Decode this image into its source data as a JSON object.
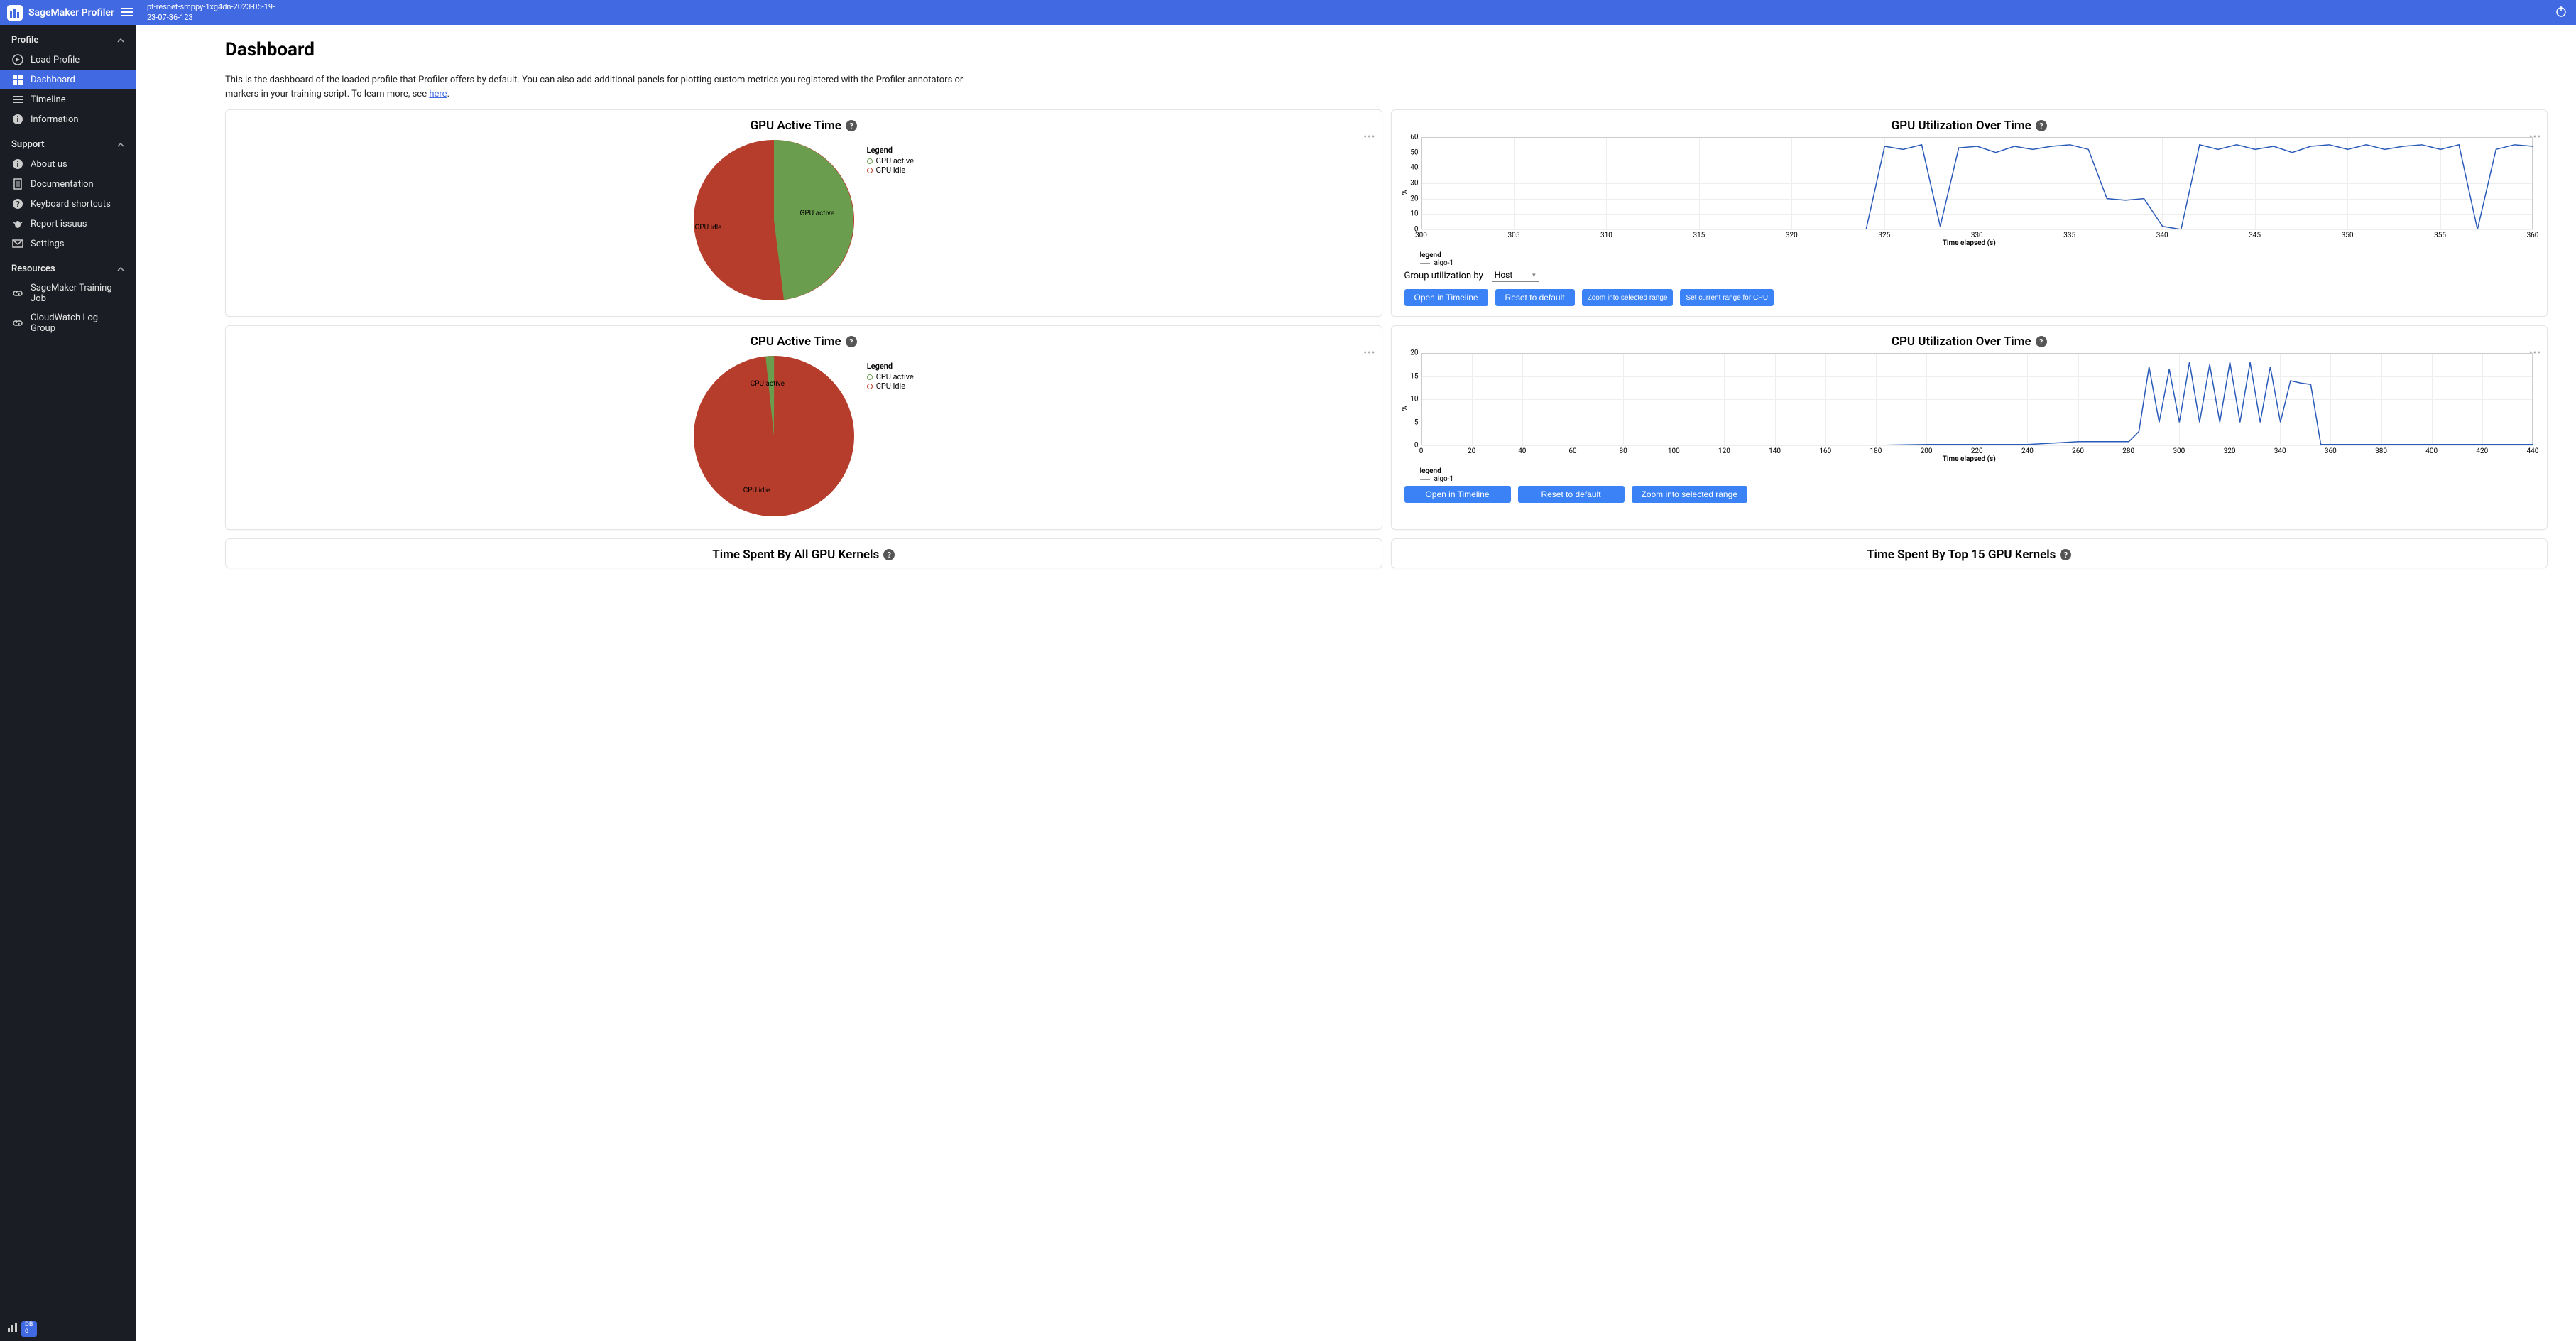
{
  "header": {
    "title": "SageMaker Profiler",
    "job_path_line1": "pt-resnet-smppy-1xg4dn-2023-05-19-",
    "job_path_line2": "23-07-36-123"
  },
  "sidebar": {
    "sections": {
      "profile": {
        "title": "Profile",
        "items": [
          "Load Profile",
          "Dashboard",
          "Timeline",
          "Information"
        ]
      },
      "support": {
        "title": "Support",
        "items": [
          "About us",
          "Documentation",
          "Keyboard shortcuts",
          "Report issuus",
          "Settings"
        ]
      },
      "resources": {
        "title": "Resources",
        "items": [
          "SageMaker Training Job",
          "CloudWatch Log Group"
        ]
      }
    },
    "footer_badge": {
      "top": "DB",
      "bottom": "0"
    }
  },
  "main": {
    "title": "Dashboard",
    "subtitle_prefix": "This is the dashboard of the loaded profile that Profiler offers by default. You can also add additional panels for plotting custom metrics you registered with the Profiler annotators or markers in your training script. To learn more, see ",
    "subtitle_link": "here",
    "subtitle_suffix": "."
  },
  "panels": {
    "gpu_pie": {
      "title": "GPU Active Time",
      "legend_title": "Legend",
      "legend_items": [
        "GPU active",
        "GPU idle"
      ],
      "label_active": "GPU active",
      "label_idle": "GPU idle"
    },
    "gpu_line": {
      "title": "GPU Utilization Over Time",
      "ylabel": "%",
      "xlabel": "Time elapsed (s)",
      "legend_title": "legend",
      "series_name": "algo-1",
      "group_label": "Group utilization by",
      "group_value": "Host",
      "buttons": [
        "Open in Timeline",
        "Reset to default",
        "Zoom into selected range",
        "Set current range for CPU"
      ]
    },
    "cpu_pie": {
      "title": "CPU Active Time",
      "legend_title": "Legend",
      "legend_items": [
        "CPU active",
        "CPU idle"
      ],
      "label_active": "CPU active",
      "label_idle": "CPU idle"
    },
    "cpu_line": {
      "title": "CPU Utilization Over Time",
      "ylabel": "%",
      "xlabel": "Time elapsed (s)",
      "legend_title": "legend",
      "series_name": "algo-1",
      "buttons": [
        "Open in Timeline",
        "Reset to default",
        "Zoom into selected range"
      ]
    },
    "bottom_left": {
      "title": "Time Spent By All GPU Kernels"
    },
    "bottom_right": {
      "title": "Time Spent By Top 15 GPU Kernels"
    }
  },
  "colors": {
    "green": "#6a9e4e",
    "red": "#b63d2b",
    "blue_line": "#2a5ab8"
  },
  "chart_data": [
    {
      "id": "gpu_pie",
      "type": "pie",
      "title": "GPU Active Time",
      "series": [
        {
          "name": "GPU active",
          "value": 52,
          "color": "#6a9e4e"
        },
        {
          "name": "GPU idle",
          "value": 48,
          "color": "#b63d2b"
        }
      ]
    },
    {
      "id": "gpu_util_line",
      "type": "line",
      "title": "GPU Utilization Over Time",
      "xlabel": "Time elapsed (s)",
      "ylabel": "%",
      "ylim": [
        0,
        60
      ],
      "xlim": [
        300,
        360
      ],
      "x_ticks": [
        300,
        305,
        310,
        315,
        320,
        325,
        330,
        335,
        340,
        345,
        350,
        355,
        360
      ],
      "y_ticks": [
        0,
        10,
        20,
        30,
        40,
        50,
        60
      ],
      "series": [
        {
          "name": "algo-1",
          "x": [
            300,
            305,
            310,
            315,
            320,
            323,
            324,
            325,
            326,
            327,
            328,
            329,
            330,
            331,
            332,
            333,
            334,
            335,
            336,
            337,
            338,
            339,
            340,
            341,
            342,
            343,
            344,
            345,
            346,
            347,
            348,
            349,
            350,
            351,
            352,
            353,
            354,
            355,
            356,
            357,
            358,
            359,
            360
          ],
          "values": [
            0,
            0,
            0,
            0,
            0,
            0,
            0,
            54,
            52,
            55,
            2,
            53,
            54,
            50,
            54,
            52,
            54,
            55,
            52,
            20,
            19,
            20,
            2,
            0,
            55,
            52,
            55,
            52,
            54,
            50,
            54,
            55,
            52,
            55,
            52,
            54,
            55,
            52,
            55,
            0,
            52,
            55,
            54
          ]
        }
      ]
    },
    {
      "id": "cpu_pie",
      "type": "pie",
      "title": "CPU Active Time",
      "series": [
        {
          "name": "CPU active",
          "value": 3,
          "color": "#6a9e4e"
        },
        {
          "name": "CPU idle",
          "value": 97,
          "color": "#b63d2b"
        }
      ]
    },
    {
      "id": "cpu_util_line",
      "type": "line",
      "title": "CPU Utilization Over Time",
      "xlabel": "Time elapsed (s)",
      "ylabel": "%",
      "ylim": [
        0,
        20
      ],
      "xlim": [
        0,
        440
      ],
      "x_ticks": [
        0,
        20,
        40,
        60,
        80,
        100,
        120,
        140,
        160,
        180,
        200,
        220,
        240,
        260,
        280,
        300,
        320,
        340,
        360,
        380,
        400,
        420,
        440
      ],
      "y_ticks": [
        0,
        5,
        10,
        15,
        20
      ],
      "series": [
        {
          "name": "algo-1",
          "x": [
            0,
            20,
            40,
            60,
            80,
            100,
            120,
            140,
            160,
            180,
            200,
            220,
            240,
            260,
            280,
            284,
            288,
            292,
            296,
            300,
            304,
            308,
            312,
            316,
            320,
            324,
            328,
            332,
            336,
            340,
            344,
            348,
            352,
            356,
            360,
            380,
            400,
            420,
            440
          ],
          "values": [
            0,
            0,
            0,
            0,
            0,
            0,
            0,
            0,
            0,
            0,
            0.2,
            0.2,
            0.2,
            0.8,
            0.8,
            3,
            17,
            5,
            16.5,
            5,
            18,
            5,
            17.5,
            5,
            18,
            5,
            18,
            5,
            17,
            5,
            14,
            13.5,
            13.2,
            0.2,
            0.2,
            0.2,
            0.2,
            0.2,
            0.2
          ]
        }
      ]
    }
  ]
}
